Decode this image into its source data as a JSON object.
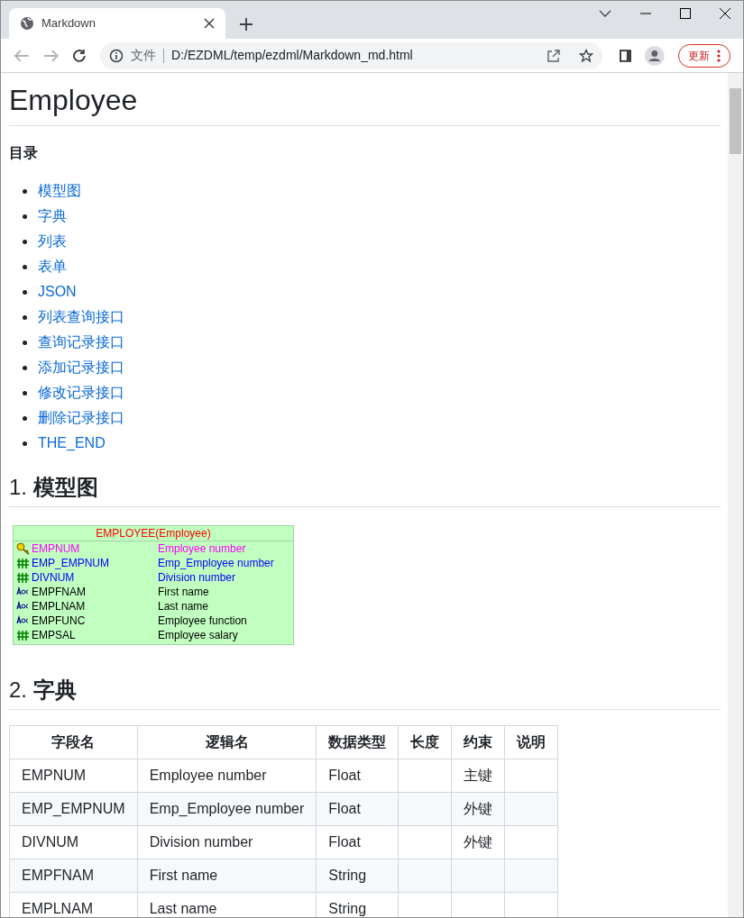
{
  "browser": {
    "tab": {
      "title": "Markdown",
      "selected": true
    },
    "address": {
      "security_label": "文件",
      "url": "D:/EZDML/temp/ezdml/Markdown_md.html"
    },
    "update_button": "更新"
  },
  "page": {
    "title": "Employee",
    "toc": {
      "heading": "目录",
      "items": [
        {
          "label": "模型图"
        },
        {
          "label": "字典"
        },
        {
          "label": "列表"
        },
        {
          "label": "表单"
        },
        {
          "label": "JSON"
        },
        {
          "label": "列表查询接口"
        },
        {
          "label": "查询记录接口"
        },
        {
          "label": "添加记录接口"
        },
        {
          "label": "修改记录接口"
        },
        {
          "label": "删除记录接口"
        },
        {
          "label": "THE_END"
        }
      ]
    },
    "model_section": {
      "heading": "1. **模型图**",
      "diagram": {
        "title": "EMPLOYEE(Employee)",
        "fields": [
          {
            "name": "EMPNUM",
            "label": "Employee number",
            "kind": "key",
            "color": "#ff00ff"
          },
          {
            "name": "EMP_EMPNUM",
            "label": "Emp_Employee number",
            "kind": "number",
            "color": "#0000ff"
          },
          {
            "name": "DIVNUM",
            "label": "Division number",
            "kind": "number",
            "color": "#0000ff"
          },
          {
            "name": "EMPFNAM",
            "label": "First name",
            "kind": "text",
            "color": "#000000"
          },
          {
            "name": "EMPLNAM",
            "label": "Last name",
            "kind": "text",
            "color": "#000000"
          },
          {
            "name": "EMPFUNC",
            "label": "Employee function",
            "kind": "text",
            "color": "#000000"
          },
          {
            "name": "EMPSAL",
            "label": "Employee salary",
            "kind": "number",
            "color": "#000000"
          }
        ]
      }
    },
    "dictionary_section": {
      "heading": "2. **字典**",
      "table": {
        "columns": [
          "字段名",
          "逻辑名",
          "数据类型",
          "长度",
          "约束",
          "说明"
        ],
        "rows": [
          {
            "field": "EMPNUM",
            "logical_name": "Employee number",
            "data_type": "Float",
            "constraint": "主键"
          },
          {
            "field": "EMP_EMPNUM",
            "logical_name": "Emp_Employee number",
            "data_type": "Float",
            "constraint": "外键"
          },
          {
            "field": "DIVNUM",
            "logical_name": "Division number",
            "data_type": "Float",
            "constraint": "外键"
          },
          {
            "field": "EMPFNAM",
            "logical_name": "First name",
            "data_type": "String"
          },
          {
            "field": "EMPLNAM",
            "logical_name": "Last name",
            "data_type": "String"
          }
        ]
      }
    }
  }
}
